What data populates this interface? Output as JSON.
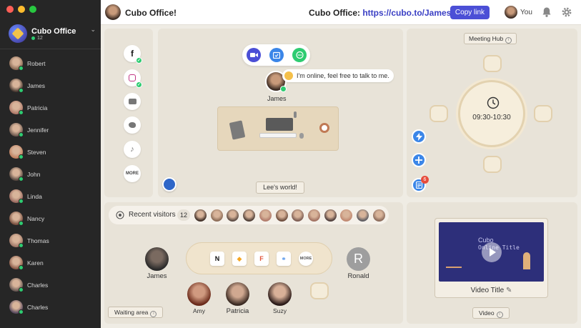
{
  "sidebar": {
    "org_name": "Cubo Office",
    "org_count": "12",
    "members": [
      {
        "name": "Robert",
        "color": "#8a6a55"
      },
      {
        "name": "James",
        "color": "#4a3a32"
      },
      {
        "name": "Patricia",
        "color": "#b07a6a"
      },
      {
        "name": "Jennifer",
        "color": "#6f5a50"
      },
      {
        "name": "Steven",
        "color": "#c08060"
      },
      {
        "name": "John",
        "color": "#5a4a42"
      },
      {
        "name": "Linda",
        "color": "#9a6a60"
      },
      {
        "name": "Nancy",
        "color": "#7a5040"
      },
      {
        "name": "Thomas",
        "color": "#a07868"
      },
      {
        "name": "Karen",
        "color": "#8a5a48"
      },
      {
        "name": "Charles",
        "color": "#6a5a55"
      },
      {
        "name": "Charles",
        "color": "#5a4a60"
      }
    ]
  },
  "topbar": {
    "room_title": "Cubo Office!",
    "link_label": "Cubo Office: ",
    "link_url": "https://cubo.to/James",
    "copy_label": "Copy link",
    "you_label": "You"
  },
  "social": {
    "facebook": "f",
    "more": "MORE"
  },
  "world": {
    "status_text": "I'm online, feel free to talk to me.",
    "user_name": "James",
    "label": "Lee's world!"
  },
  "hub": {
    "label": "Meeting Hub",
    "time": "09:30-10:30",
    "notes_badge": "6"
  },
  "waiting": {
    "visitors_label": "Recent visitors",
    "visitors_count": "12",
    "visitor_colors": [
      "#3a2a22",
      "#8a6a55",
      "#5a4a42",
      "#4a3a32",
      "#b07a6a",
      "#6a4a3a",
      "#7a5a50",
      "#a07060",
      "#4a3a38",
      "#c08870",
      "#5a5a60",
      "#8a6a5a"
    ],
    "more_label": "MORE",
    "people": {
      "james": "James",
      "ronald": "Ronald",
      "ronald_initial": "R",
      "amy": "Amy",
      "patricia": "Patricia",
      "suzy": "Suzy"
    },
    "label": "Waiting area"
  },
  "video": {
    "screen_title": "Cubo",
    "screen_sub": "Online Title",
    "title": "Video Title",
    "label": "Video"
  },
  "colors": {
    "accent": "#4b4fd6",
    "online": "#2ecc71",
    "badge": "#e74c3c"
  }
}
